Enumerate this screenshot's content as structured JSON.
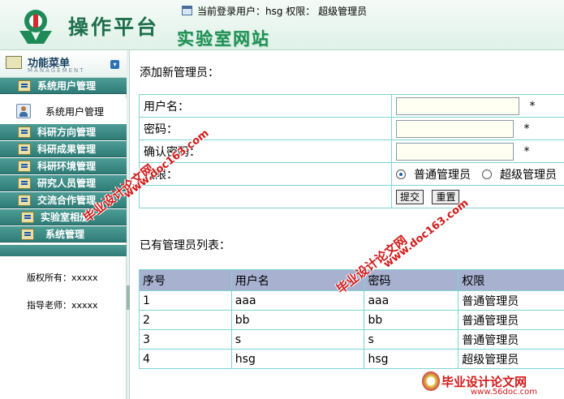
{
  "header": {
    "platform_title": "操作平台",
    "site_title": "实验室网站",
    "login_info": "当前登录用户：hsg 权限：  超级管理员"
  },
  "sidebar": {
    "menu_title": "功能菜单",
    "menu_subtitle": "MANAGEMENT",
    "items": [
      {
        "label": "系统用户管理"
      },
      {
        "label": "系统用户管理"
      },
      {
        "label": "科研方向管理"
      },
      {
        "label": "科研成果管理"
      },
      {
        "label": "科研环境管理"
      },
      {
        "label": "研究人员管理"
      },
      {
        "label": "交流合作管理"
      },
      {
        "label": "实验室相册"
      },
      {
        "label": "系统管理"
      }
    ],
    "copyright": "版权所有：xxxxx",
    "teacher": "指导老师：xxxxx"
  },
  "form": {
    "section_title": "添加新管理员：",
    "username_label": "用户名：",
    "password_label": "密码：",
    "confirm_label": "确认密码：",
    "permission_label": "权限：",
    "required_mark": "*",
    "username_value": "",
    "password_value": "",
    "confirm_value": "",
    "permission_options": [
      {
        "label": "普通管理员",
        "checked": true
      },
      {
        "label": "超级管理员",
        "checked": false
      }
    ],
    "submit_label": "提交",
    "reset_label": "重置"
  },
  "admin_list": {
    "section_title": "已有管理员列表：",
    "columns": [
      "序号",
      "用户名",
      "密码",
      "权限"
    ],
    "rows": [
      [
        "1",
        "aaa",
        "aaa",
        "普通管理员"
      ],
      [
        "2",
        "bb",
        "bb",
        "普通管理员"
      ],
      [
        "3",
        "s",
        "s",
        "普通管理员"
      ],
      [
        "4",
        "hsg",
        "hsg",
        "超级管理员"
      ]
    ]
  },
  "watermarks": {
    "text_1": "毕业设计论文网",
    "text_2": "www.doc163.com",
    "brand": "毕业设计论文网",
    "site": "www.56doc.com"
  },
  "colors": {
    "nav": "#3a8a84",
    "table_border": "#7fd3d3",
    "table_header": "#a8b1d0",
    "brand": "#1e6f4c",
    "watermark": "#d11a1a"
  }
}
